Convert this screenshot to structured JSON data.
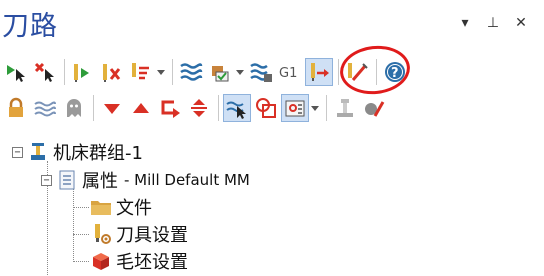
{
  "panel": {
    "title": "刀路"
  },
  "window_controls": [
    {
      "name": "dropdown-arrow",
      "glyph": "▾"
    },
    {
      "name": "pin-icon",
      "glyph": "⊥"
    },
    {
      "name": "close-icon",
      "glyph": "✕"
    }
  ],
  "toolbar_row1": [
    "select-all-icon",
    "deselect-all-icon",
    "select-toolpaths-icon",
    "clear-toolpaths-icon",
    "regenerate-icon",
    "backplot-icon",
    "verify-icon",
    "regen-dirty-icon",
    "g1-icon",
    "post-output-icon",
    "highlight-edit-icon",
    "help-icon"
  ],
  "toolbar_row2": [
    "lock-icon",
    "wave-icon",
    "ghost-icon",
    "move-down-icon",
    "move-up-icon",
    "insert-arrow-icon",
    "expand-collapse-icon",
    "single-select-icon",
    "region-icon",
    "display-options-icon",
    "tool-manager-icon",
    "stock-icon"
  ],
  "accent_colors": {
    "red": "#d93025",
    "blue": "#2b4ea2",
    "teal": "#3a7ea8",
    "yellow": "#e2b13c"
  },
  "tree": {
    "root": {
      "label": "机床群组-1",
      "expanded": true
    },
    "properties": {
      "label": "属性",
      "sublabel": "- Mill Default MM",
      "expanded": true
    },
    "children": [
      {
        "label": "文件",
        "icon": "folder-icon"
      },
      {
        "label": "刀具设置",
        "icon": "tool-settings-icon"
      },
      {
        "label": "毛坯设置",
        "icon": "stock-setup-icon"
      }
    ]
  },
  "expander": {
    "collapse": "−"
  }
}
